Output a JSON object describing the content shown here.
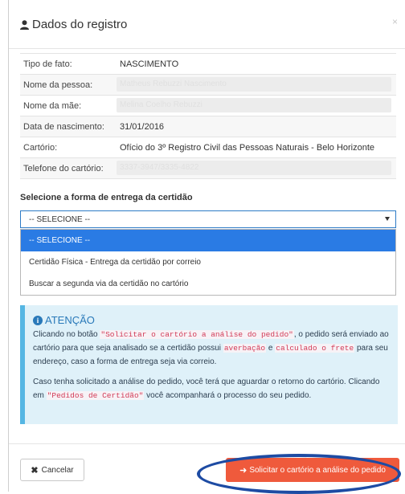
{
  "modal": {
    "title": "Dados do registro",
    "close": "×"
  },
  "info": {
    "rows": [
      {
        "label": "Tipo de fato:",
        "value": "NASCIMENTO"
      },
      {
        "label": "Nome da pessoa:",
        "value": "Matheus Rebuzzi Nascimento"
      },
      {
        "label": "Nome da mãe:",
        "value": "Melina Coelho Rebuzzi"
      },
      {
        "label": "Data de nascimento:",
        "value": "31/01/2016"
      },
      {
        "label": "Cartório:",
        "value": "Ofício do 3º Registro Civil das Pessoas Naturais - Belo Horizonte"
      },
      {
        "label": "Telefone do cartório:",
        "value": "3337-3947/3335-4822"
      }
    ]
  },
  "delivery": {
    "label": "Selecione a forma de entrega da certidão",
    "selected": "-- SELECIONE --",
    "options": [
      "-- SELECIONE --",
      "Certidão Física - Entrega da certidão por correio",
      "Buscar a segunda via da certidão no cartório"
    ]
  },
  "alert": {
    "title": "ATENÇÃO",
    "p1_a": "Clicando no botão ",
    "p1_code1": "\"Solicitar o cartório a análise do pedido\"",
    "p1_b": ", o pedido será enviado ao cartório para que seja analisado se a certidão possui ",
    "p1_code2": "averbação",
    "p1_c": " e ",
    "p1_code3": "calculado o frete",
    "p1_d": " para seu endereço, caso a forma de entrega seja via correio.",
    "p2_a": "Caso tenha solicitado a análise do pedido, você terá que aguardar o retorno do cartório. Clicando em ",
    "p2_code": "\"Pedidos de Certidão\"",
    "p2_b": " você acompanhará o processo do seu pedido."
  },
  "footer": {
    "cancel": "Cancelar",
    "submit": "Solicitar o cartório a análise do pedido"
  },
  "colors": {
    "primary": "#ef5a3c",
    "accent": "#2a7be4",
    "alert_bg": "#dff1f9",
    "highlight_circle": "#1d4ba3"
  }
}
